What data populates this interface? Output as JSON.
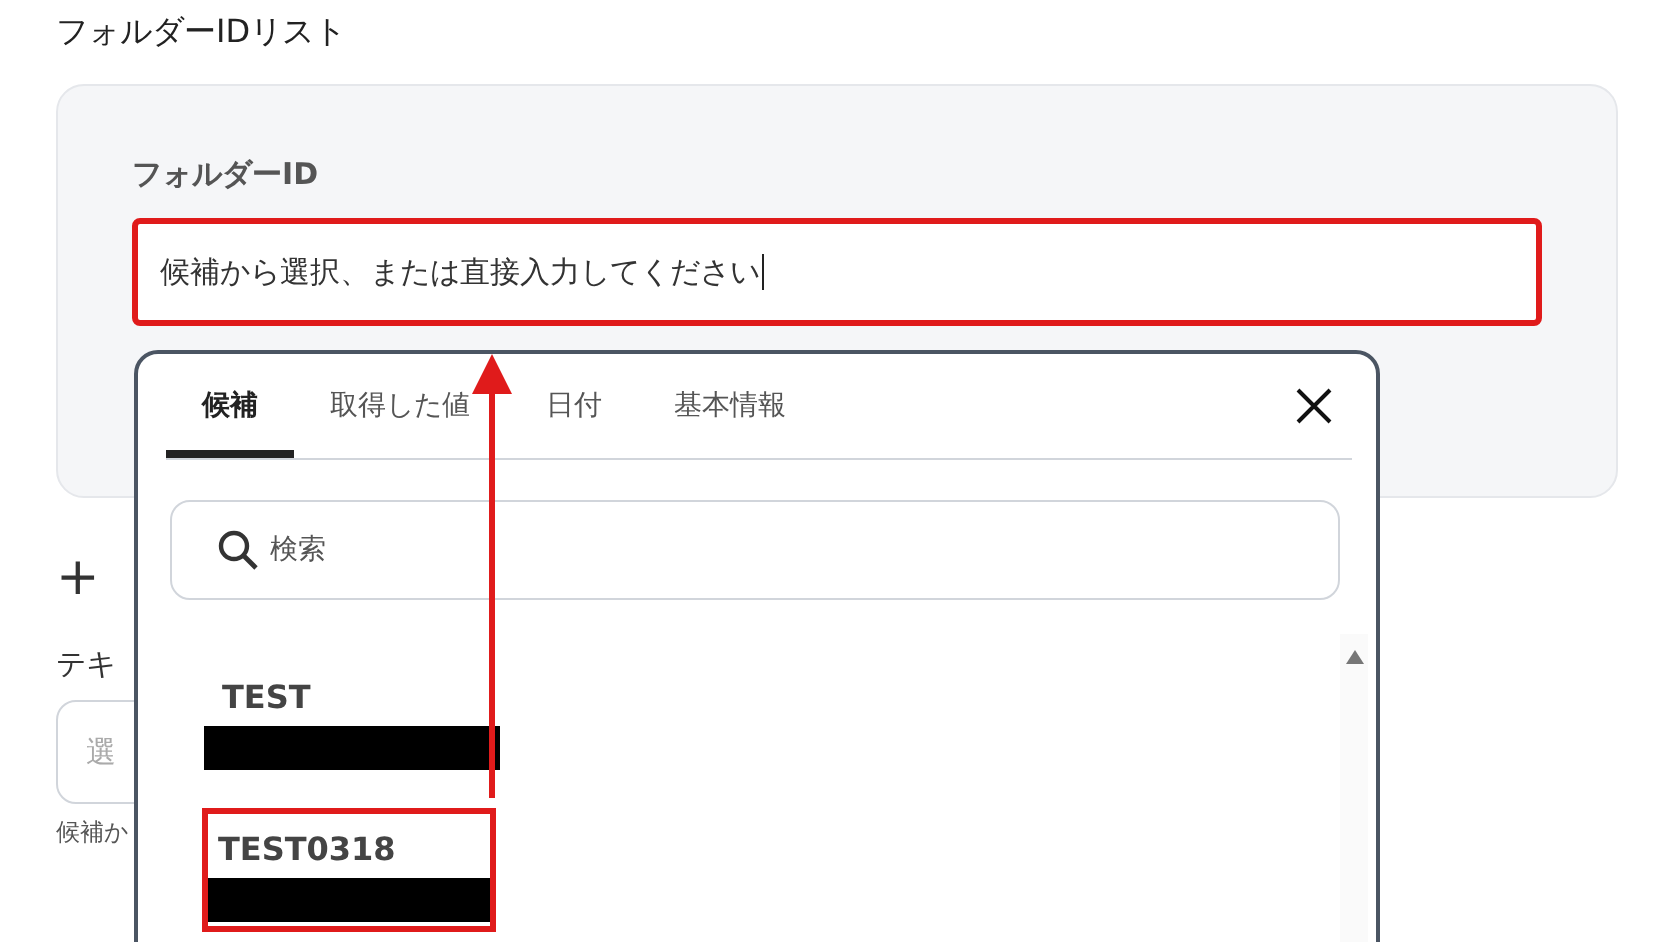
{
  "section_title": "フォルダーIDリスト",
  "folder_card": {
    "label": "フォルダーID",
    "input": {
      "value": "候補から選択、または直接入力してください",
      "highlighted": true
    }
  },
  "add_button": {
    "label": "+"
  },
  "next_field": {
    "label": "テキ",
    "placeholder": "選",
    "hint": "候補か"
  },
  "popup": {
    "tabs": [
      {
        "label": "候補",
        "selected": true
      },
      {
        "label": "取得した値",
        "selected": false
      },
      {
        "label": "日付",
        "selected": false
      },
      {
        "label": "基本情報",
        "selected": false
      }
    ],
    "search": {
      "placeholder": "検索"
    },
    "items": [
      {
        "name": "TEST",
        "redacted": true,
        "highlighted": false
      },
      {
        "name": "TEST0318",
        "redacted": true,
        "highlighted": true
      }
    ]
  }
}
